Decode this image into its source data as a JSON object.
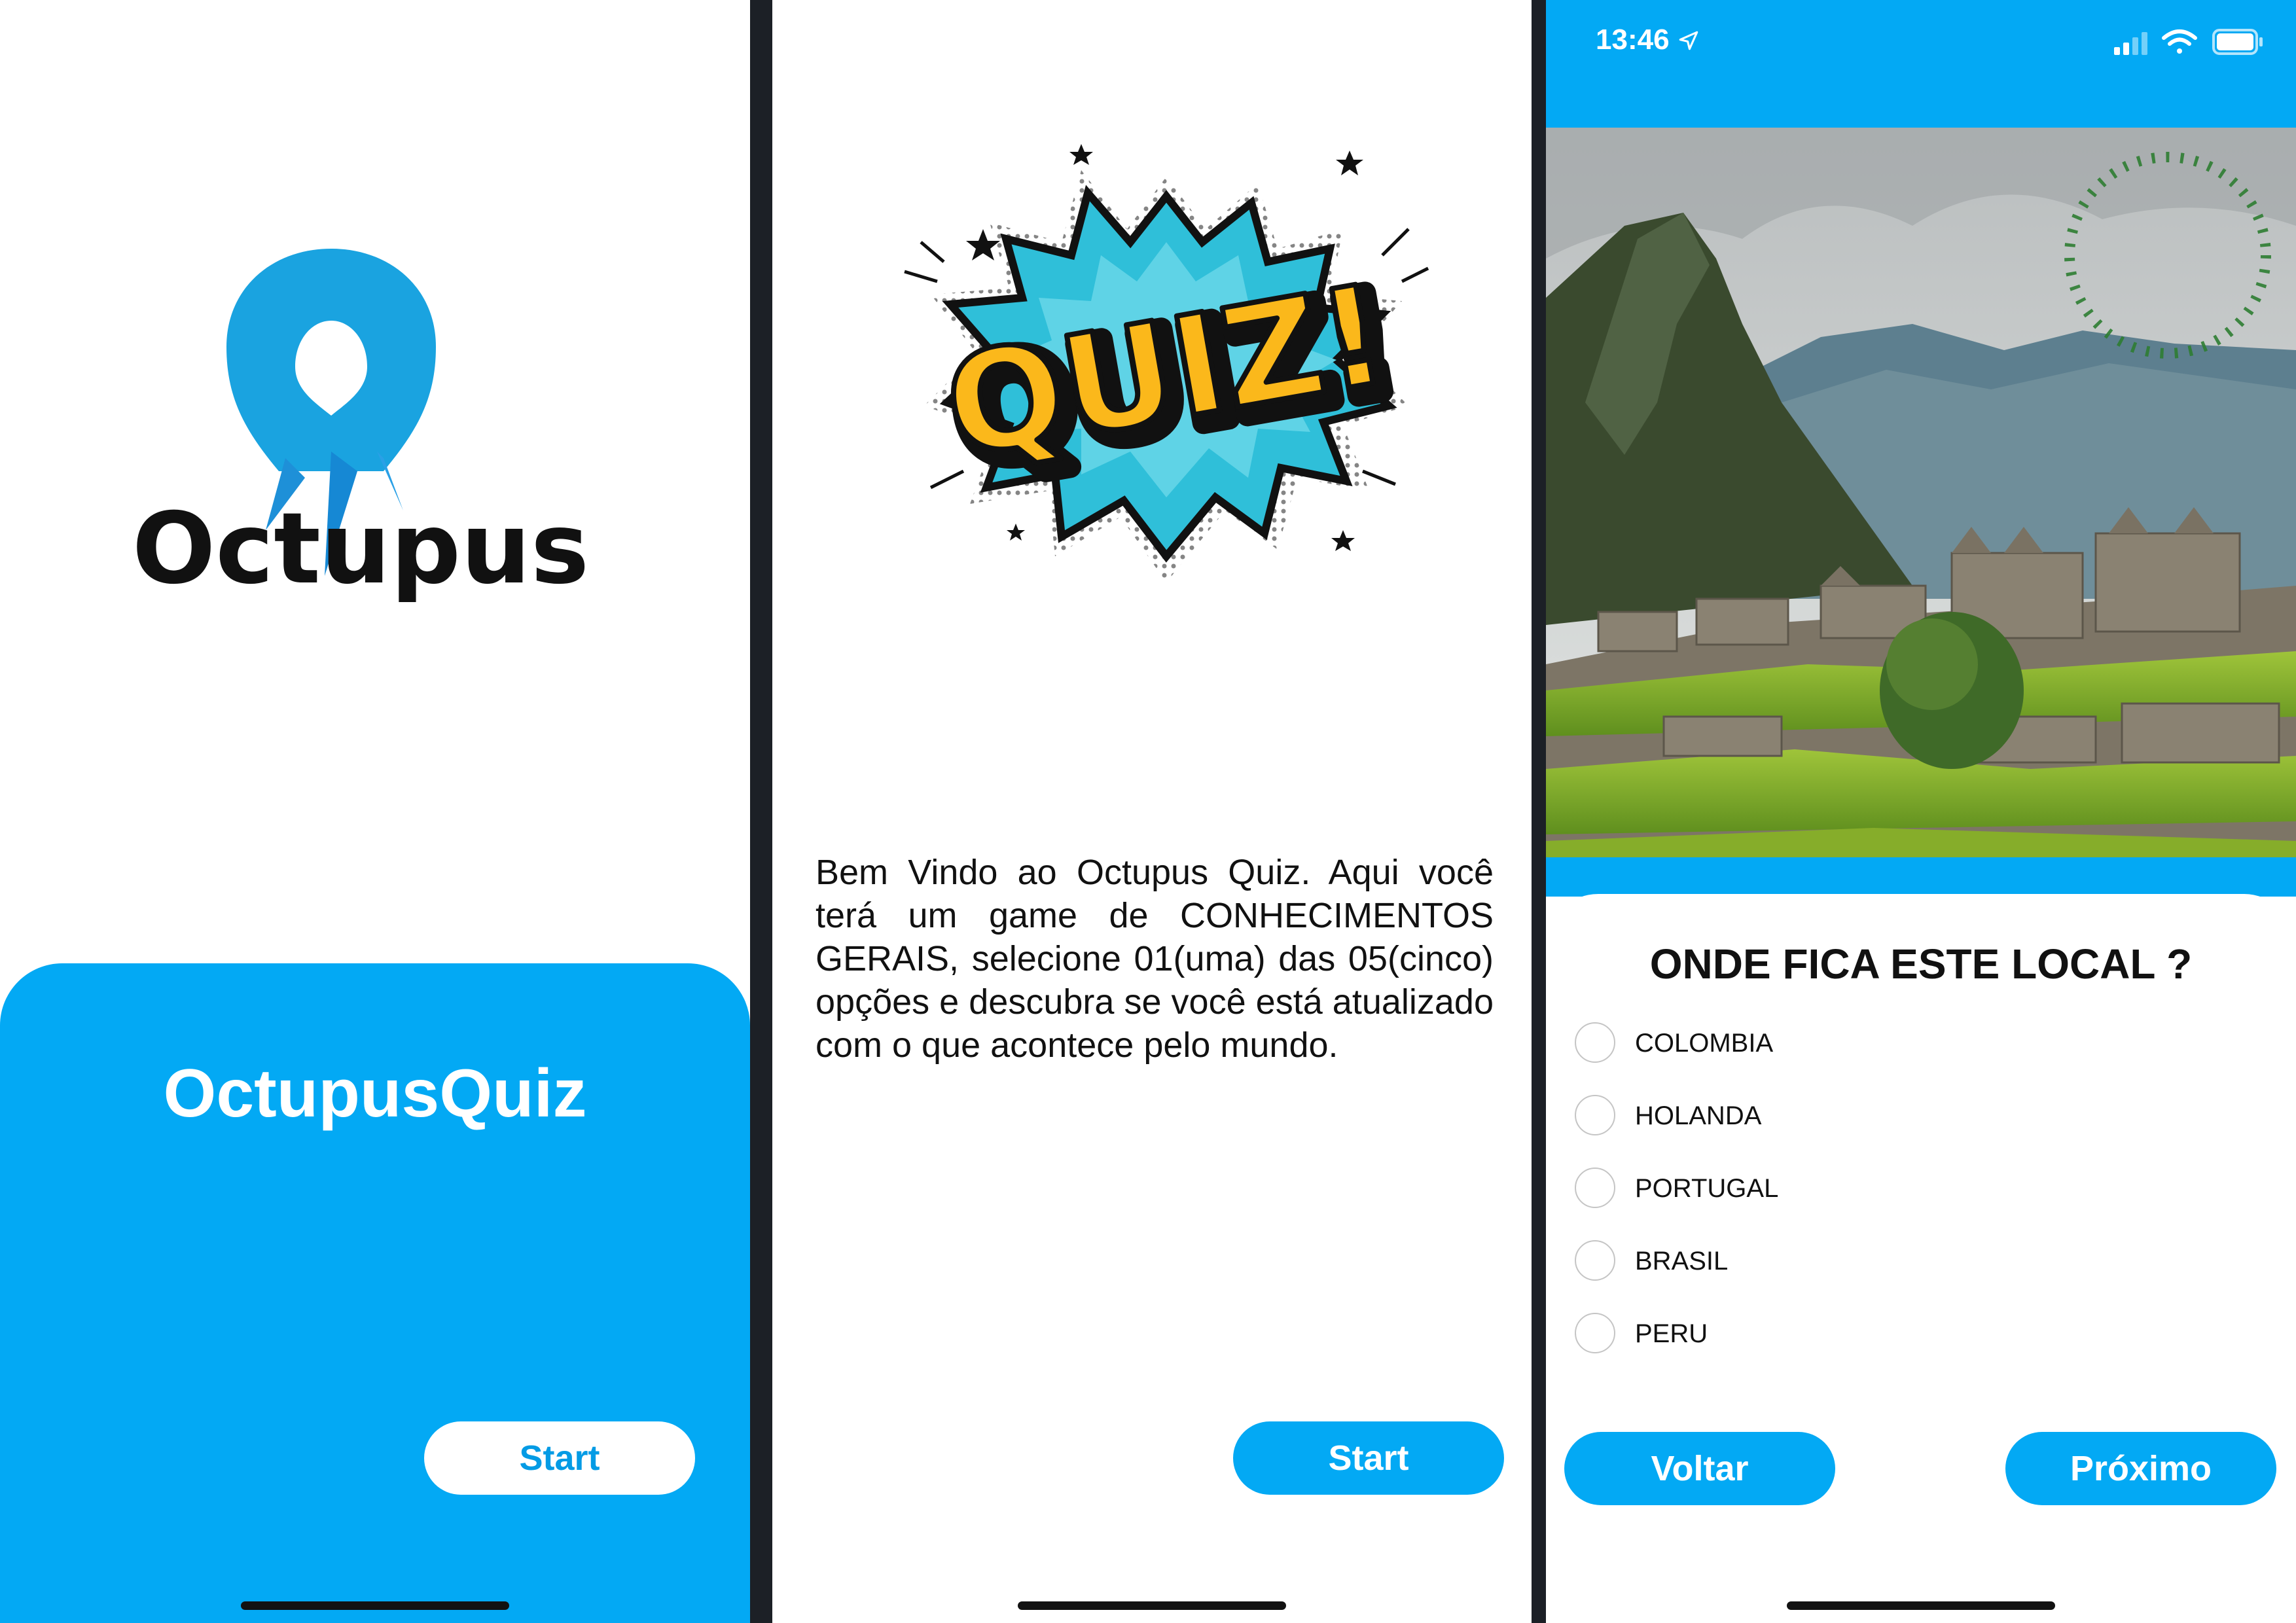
{
  "splash": {
    "logo_text": "Octupus",
    "app_name": "OctupusQuiz",
    "start_label": "Start"
  },
  "intro": {
    "logo_text": "QUIZ!",
    "description": "Bem Vindo ao Octupus Quiz. Aqui você terá um game de CONHECIMENTOS GERAIS, selecione 01(uma) das 05(cinco) opções e descubra se você está atualizado com o que acontece pelo mundo.",
    "start_label": "Start"
  },
  "question": {
    "status_time": "13:46",
    "title": "ONDE FICA ESTE LOCAL ?",
    "options": [
      "COLOMBIA",
      "HOLANDA",
      "PORTUGAL",
      "BRASIL",
      "PERU"
    ],
    "back_label": "Voltar",
    "next_label": "Próximo"
  },
  "colors": {
    "primary_blue": "#03a9f4",
    "quiz_yellow": "#fbb81b",
    "timer_green": "#2e7d32"
  }
}
